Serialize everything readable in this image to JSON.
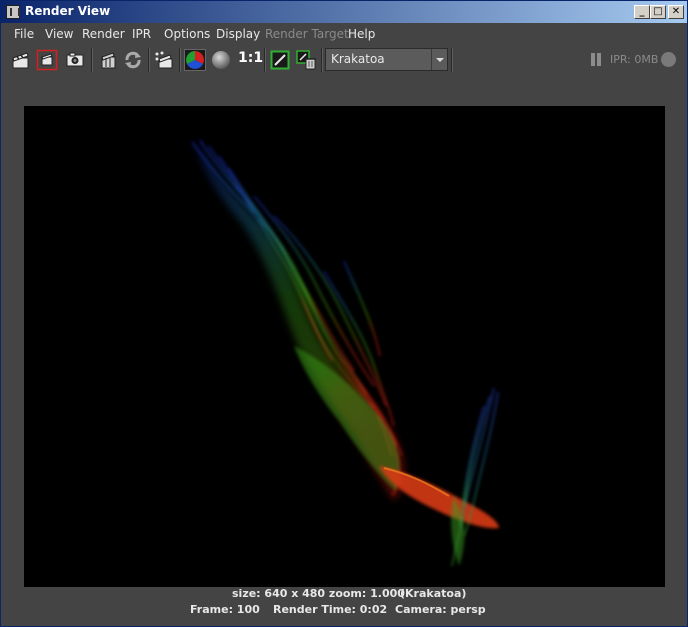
{
  "window": {
    "title": "Render View",
    "controls": {
      "minimize": "_",
      "maximize": "□",
      "close": "✕"
    }
  },
  "menubar": {
    "items": [
      {
        "label": "File",
        "enabled": true
      },
      {
        "label": "View",
        "enabled": true
      },
      {
        "label": "Render",
        "enabled": true
      },
      {
        "label": "IPR",
        "enabled": true
      },
      {
        "label": "Options",
        "enabled": true
      },
      {
        "label": "Display",
        "enabled": true
      },
      {
        "label": "Render Target",
        "enabled": false
      },
      {
        "label": "Help",
        "enabled": true
      }
    ]
  },
  "toolbar": {
    "ratio_label": "1:1",
    "renderer_value": "Krakatoa",
    "ipr_status": "IPR: 0MB",
    "icons": [
      "render-clapper-icon",
      "render-region-icon",
      "snapshot-camera-icon",
      "redo-render-icon",
      "refresh-icon",
      "ipr-render-icon",
      "color-channels-icon",
      "alpha-channel-icon",
      "keep-image-icon",
      "remove-image-icon"
    ]
  },
  "status": {
    "size_zoom": "size: 640 x 480 zoom: 1.000",
    "renderer": "(Krakatoa)",
    "frame": "Frame: 100",
    "render_time": "Render Time: 0:02",
    "camera": "Camera: persp"
  },
  "colors": {
    "panel": "#444444",
    "canvas": "#000000",
    "titlebar_start": "#0a246a",
    "titlebar_end": "#a6caf0",
    "particle_blue": "#1a33d8",
    "particle_green": "#3fae1a",
    "particle_red": "#d8281a"
  }
}
